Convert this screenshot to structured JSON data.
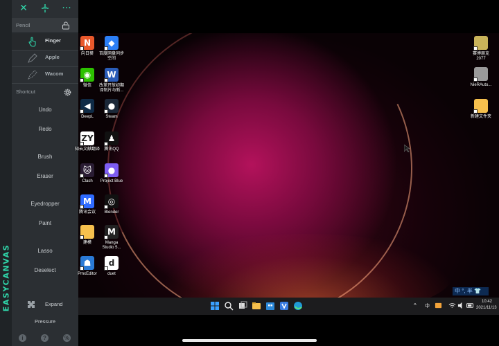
{
  "sidebar": {
    "brand": "EASYCANVAS",
    "pencil_label": "Pencil",
    "modes": [
      {
        "label": "Finger",
        "active": true
      },
      {
        "label": "Apple",
        "active": false
      },
      {
        "label": "Wacom",
        "active": false
      }
    ],
    "shortcut_label": "Shortcut",
    "commands": [
      "Undo",
      "Redo",
      "Brush",
      "Eraser",
      "Eyedropper",
      "Paint",
      "Lasso",
      "Deselect"
    ],
    "expand_label": "Expand",
    "pressure_label": "Pressure",
    "bottom_icons": [
      "i",
      "?",
      "%"
    ],
    "accent_color": "#2fd4a8"
  },
  "desktop": {
    "icons_left": [
      {
        "label": "向日葵",
        "color": "#e9582b",
        "glyph": "N",
        "icon": "sunlogin-icon"
      },
      {
        "label": "百度网盘同步\n空间",
        "color": "#2c7ff6",
        "glyph": "◆",
        "icon": "baidu-netdisk-icon"
      },
      {
        "label": "微信",
        "color": "#2dc100",
        "glyph": "◉",
        "icon": "wechat-icon"
      },
      {
        "label": "改革开放初期\n译制片与新...",
        "color": "#2a5cb8",
        "glyph": "W",
        "icon": "word-document-icon"
      },
      {
        "label": "DeepL",
        "color": "#0f2b46",
        "glyph": "◀",
        "icon": "deepl-icon"
      },
      {
        "label": "Steam",
        "color": "#1b2838",
        "glyph": "●",
        "icon": "steam-icon"
      },
      {
        "label": "知云文献翻译",
        "color": "#ffffff",
        "glyph": "ZY",
        "icon": "zhiyun-icon"
      },
      {
        "label": "腾讯QQ",
        "color": "#111111",
        "glyph": "♟",
        "icon": "qq-icon"
      },
      {
        "label": "Clash",
        "color": "#2a1c33",
        "glyph": "🐱",
        "icon": "clash-icon"
      },
      {
        "label": "Project Blue",
        "color": "#7d5df2",
        "glyph": "●",
        "icon": "project-blue-icon"
      },
      {
        "label": "腾讯会议",
        "color": "#2f6bff",
        "glyph": "M",
        "icon": "tencent-meeting-icon"
      },
      {
        "label": "Blender",
        "color": "#111111",
        "glyph": "◎",
        "icon": "blender-icon"
      },
      {
        "label": "建模",
        "color": "#f6c04d",
        "glyph": "",
        "icon": "folder-icon"
      },
      {
        "label": "Manga\nStudio 5...",
        "color": "#222222",
        "glyph": "M",
        "icon": "manga-studio-icon"
      },
      {
        "label": "PmxEditor",
        "color": "#2a7ad6",
        "glyph": "☗",
        "icon": "pmxeditor-icon"
      },
      {
        "label": "duet",
        "color": "#ffffff",
        "glyph": "d",
        "icon": "duet-icon"
      }
    ],
    "icons_right": [
      {
        "label": "赛博朋克\n2077",
        "color": "#c9b35a",
        "glyph": "",
        "icon": "cyberpunk-icon"
      },
      {
        "label": "NieRAuto...",
        "color": "#9a9a9a",
        "glyph": "",
        "icon": "nier-icon"
      },
      {
        "label": "新建文件夹",
        "color": "#f6c04d",
        "glyph": "",
        "icon": "folder-icon"
      }
    ],
    "ime_text": "中 °, 半 👕"
  },
  "taskbar": {
    "apps": [
      "windows-start-icon",
      "search-icon",
      "task-view-icon",
      "file-explorer-icon",
      "store-icon",
      "app-icon",
      "edge-icon"
    ],
    "tray_text": "中",
    "time": "10:42",
    "date": "2021/11/13"
  }
}
